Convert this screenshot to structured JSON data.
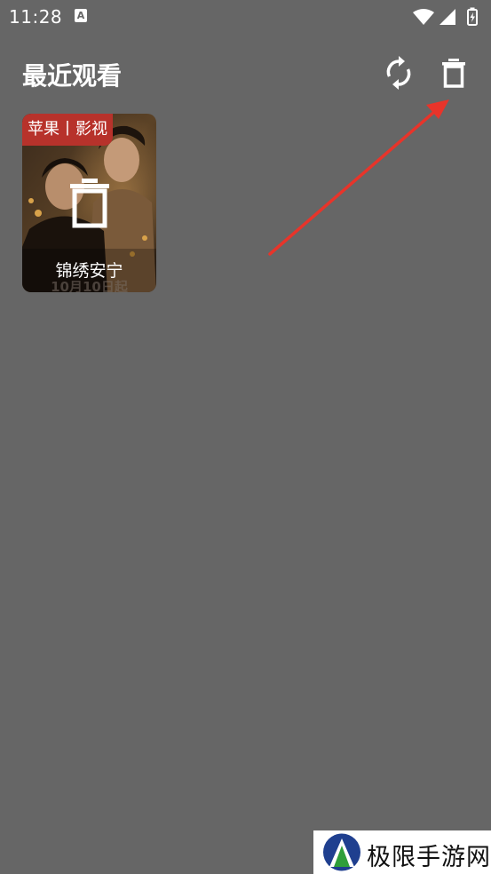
{
  "status_bar": {
    "time": "11:28",
    "notification_icon": "accessibility-a-icon",
    "icons": [
      "wifi-icon",
      "signal-icon",
      "battery-charging-icon"
    ]
  },
  "header": {
    "title": "最近观看",
    "refresh_icon": "refresh-icon",
    "delete_icon": "trash-icon"
  },
  "history": {
    "items": [
      {
        "title": "锦绣安宁",
        "source_badge": "苹果丨影视",
        "poster_date_text": "10月10日起",
        "delete_overlay_icon": "trash-icon"
      }
    ]
  },
  "annotation": {
    "arrow_color": "#e8342a"
  },
  "watermark": {
    "text": "极限手游网"
  },
  "colors": {
    "background": "#666666",
    "badge": "#b7322b",
    "text": "#ffffff"
  }
}
